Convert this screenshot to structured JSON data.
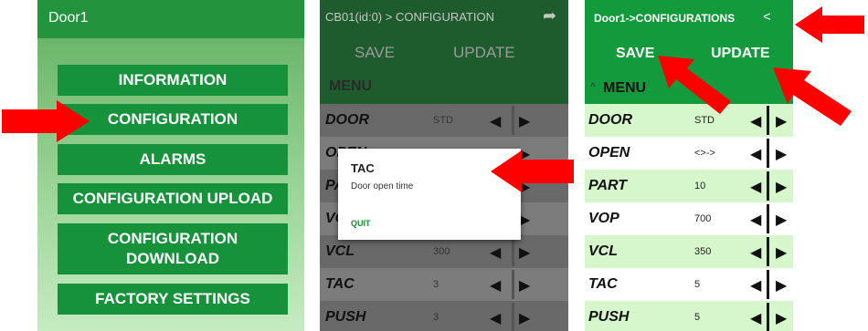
{
  "panel_home": {
    "title": "Door1",
    "buttons": [
      "INFORMATION",
      "CONFIGURATION",
      "ALARMS",
      "CONFIGURATION UPLOAD",
      "CONFIGURATION DOWNLOAD",
      "FACTORY SETTINGS"
    ]
  },
  "panel_dialog": {
    "title": "CB01(id:0) > CONFIGURATION",
    "save": "SAVE",
    "update": "UPDATE",
    "menu": "MENU",
    "rows": [
      {
        "name": "DOOR",
        "value": "STD"
      },
      {
        "name": "OPEN",
        "value": ""
      },
      {
        "name": "PART",
        "value": ""
      },
      {
        "name": "VOP",
        "value": ""
      },
      {
        "name": "VCL",
        "value": "300"
      },
      {
        "name": "TAC",
        "value": "3"
      },
      {
        "name": "PUSH",
        "value": "3"
      }
    ],
    "dialog": {
      "title": "TAC",
      "message": "Door open time",
      "quit": "QUIT"
    }
  },
  "panel_config": {
    "title": "Door1->CONFIGURATIONS",
    "save": "SAVE",
    "update": "UPDATE",
    "menu": "MENU",
    "rows": [
      {
        "name": "DOOR",
        "value": "STD"
      },
      {
        "name": "OPEN",
        "value": "<>->"
      },
      {
        "name": "PART",
        "value": "10"
      },
      {
        "name": "VOP",
        "value": "700"
      },
      {
        "name": "VCL",
        "value": "350"
      },
      {
        "name": "TAC",
        "value": "5"
      },
      {
        "name": "PUSH",
        "value": "5"
      }
    ]
  },
  "icons": {
    "share": "share-icon",
    "forward": "forward-icon",
    "left": "left-arrow-icon",
    "right": "right-arrow-icon"
  },
  "colors": {
    "primary_green": "#129a3d",
    "light_green_row": "#d6f7cc",
    "annotation_red": "#ff0000"
  }
}
